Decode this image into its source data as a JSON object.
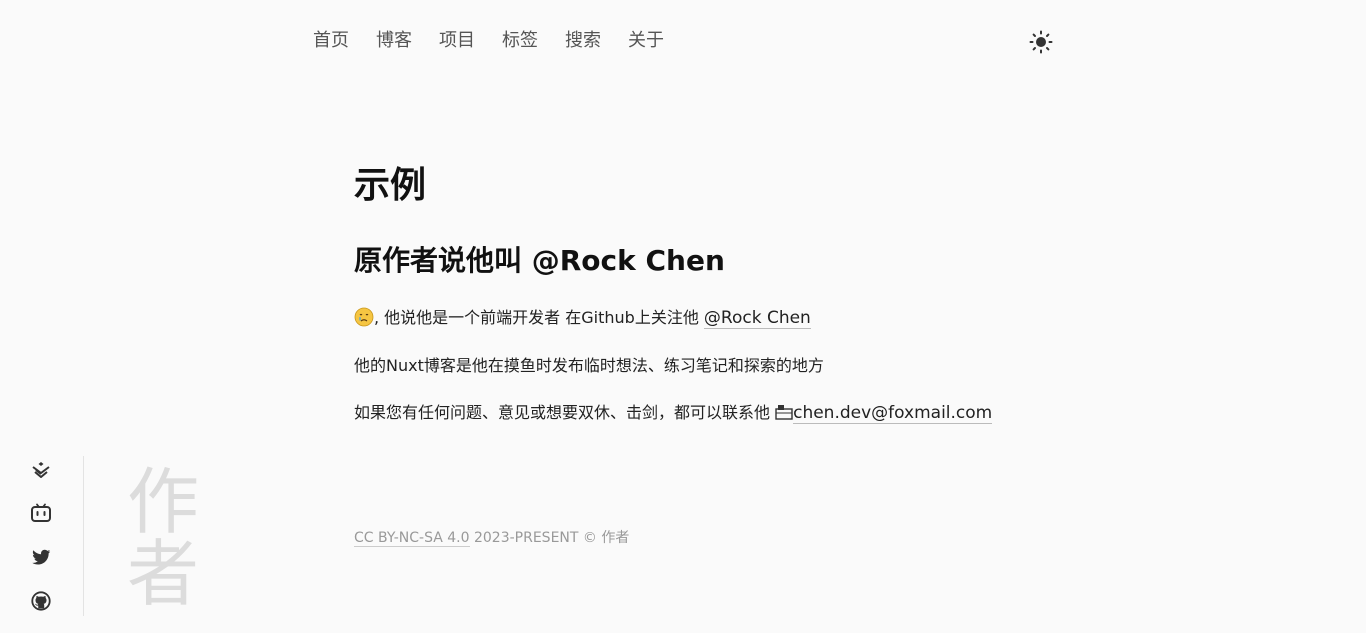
{
  "nav": {
    "items": [
      "首页",
      "博客",
      "项目",
      "标签",
      "搜索",
      "关于"
    ]
  },
  "theme_toggle": {
    "icon": "sun-icon"
  },
  "main": {
    "title": "示例",
    "subtitle": "原作者说他叫 @Rock Chen",
    "p1_text": ", 他说他是一个前端开发者 在Github上关注他 ",
    "p1_link": "@Rock Chen",
    "p2_text": "他的Nuxt博客是他在摸鱼时发布临时想法、练习笔记和探索的地方",
    "p3_text": "如果您有任何问题、意见或想要双休、击剑，都可以联系他 ",
    "p3_link": "chen.dev@foxmail.com"
  },
  "footer": {
    "license_link": "CC BY-NC-SA 4.0",
    "text": " 2023-PRESENT © 作者"
  },
  "sidebar": {
    "icons": [
      "juejin-icon",
      "bilibili-icon",
      "twitter-icon",
      "github-icon"
    ],
    "watermark": [
      "作",
      "者"
    ]
  }
}
